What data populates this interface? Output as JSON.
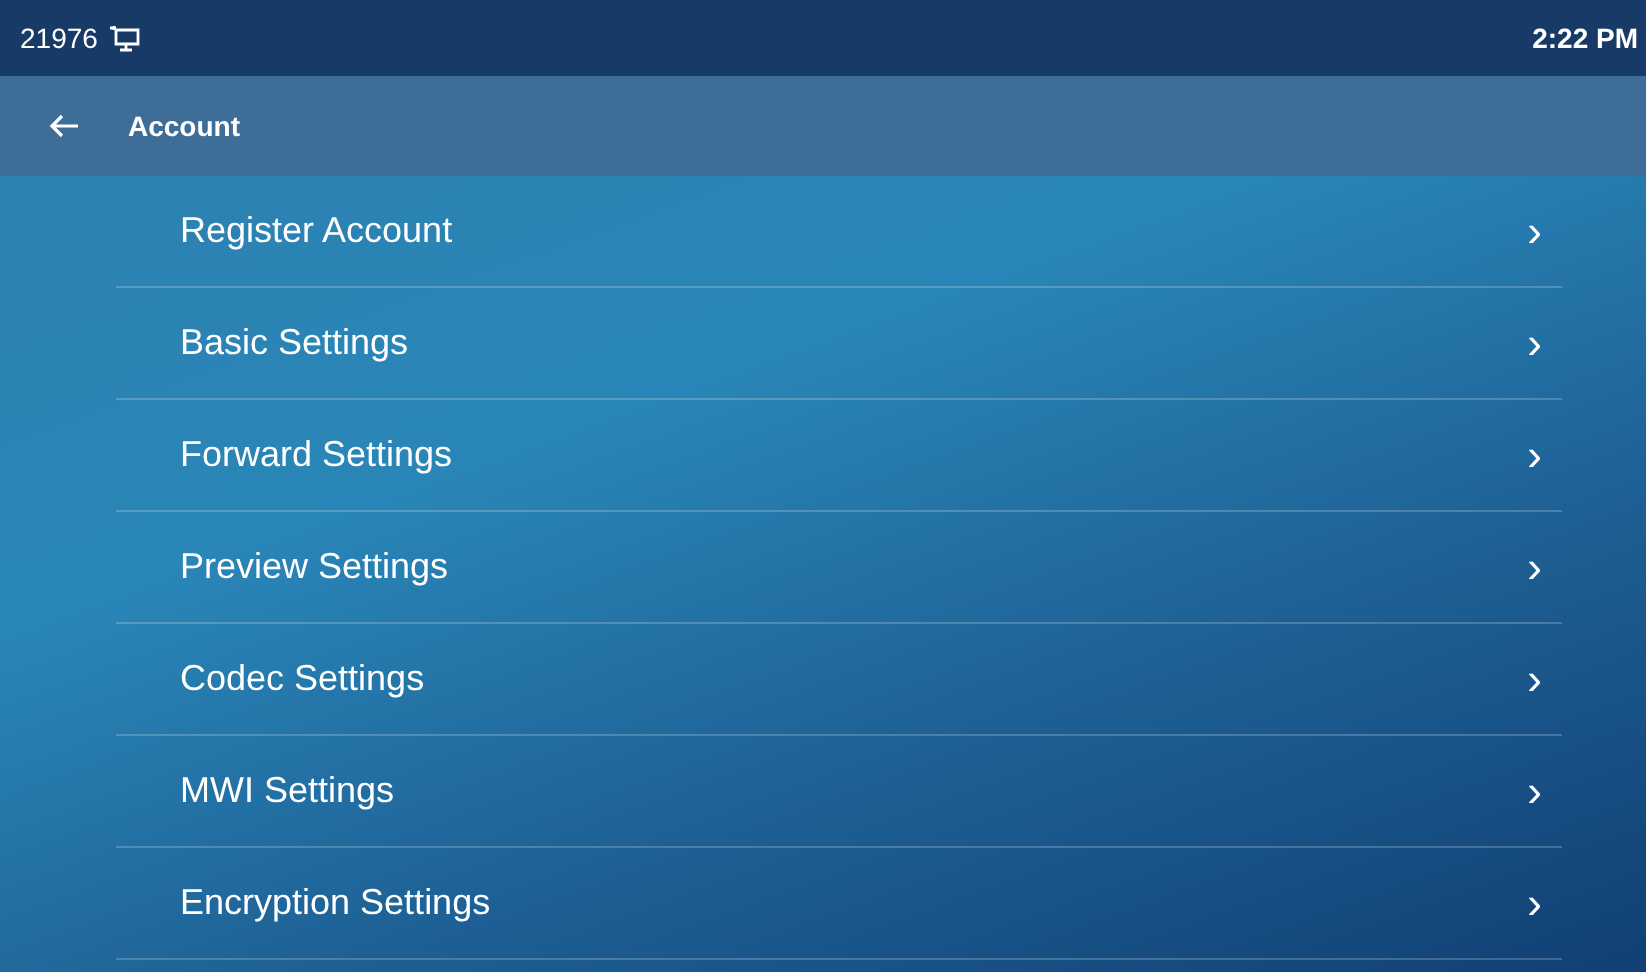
{
  "status_bar": {
    "extension": "21976",
    "time": "2:22 PM"
  },
  "header": {
    "title": "Account"
  },
  "menu_items": [
    {
      "label": "Register Account",
      "chevron": "›"
    },
    {
      "label": "Basic Settings",
      "chevron": "›"
    },
    {
      "label": "Forward Settings",
      "chevron": "›"
    },
    {
      "label": "Preview Settings",
      "chevron": "›"
    },
    {
      "label": "Codec Settings",
      "chevron": "›"
    },
    {
      "label": "MWI Settings",
      "chevron": "›"
    },
    {
      "label": "Encryption Settings",
      "chevron": "›"
    }
  ]
}
